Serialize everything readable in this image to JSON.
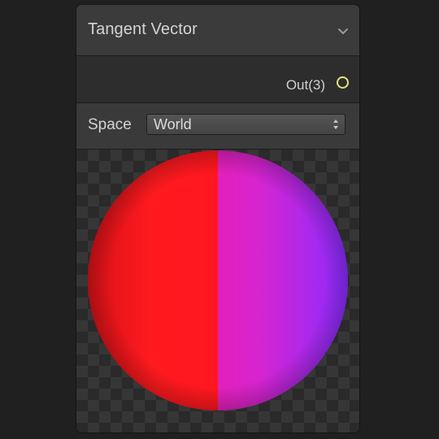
{
  "node": {
    "title": "Tangent Vector",
    "collapse_icon": "chevron-down-icon"
  },
  "ports": {
    "output_label": "Out(3)",
    "output_color": "#e4e47c"
  },
  "controls": {
    "space_label": "Space",
    "space_value": "World"
  },
  "preview": {
    "left_color": "#ff1a1a",
    "right_color": "#8a2cff"
  }
}
